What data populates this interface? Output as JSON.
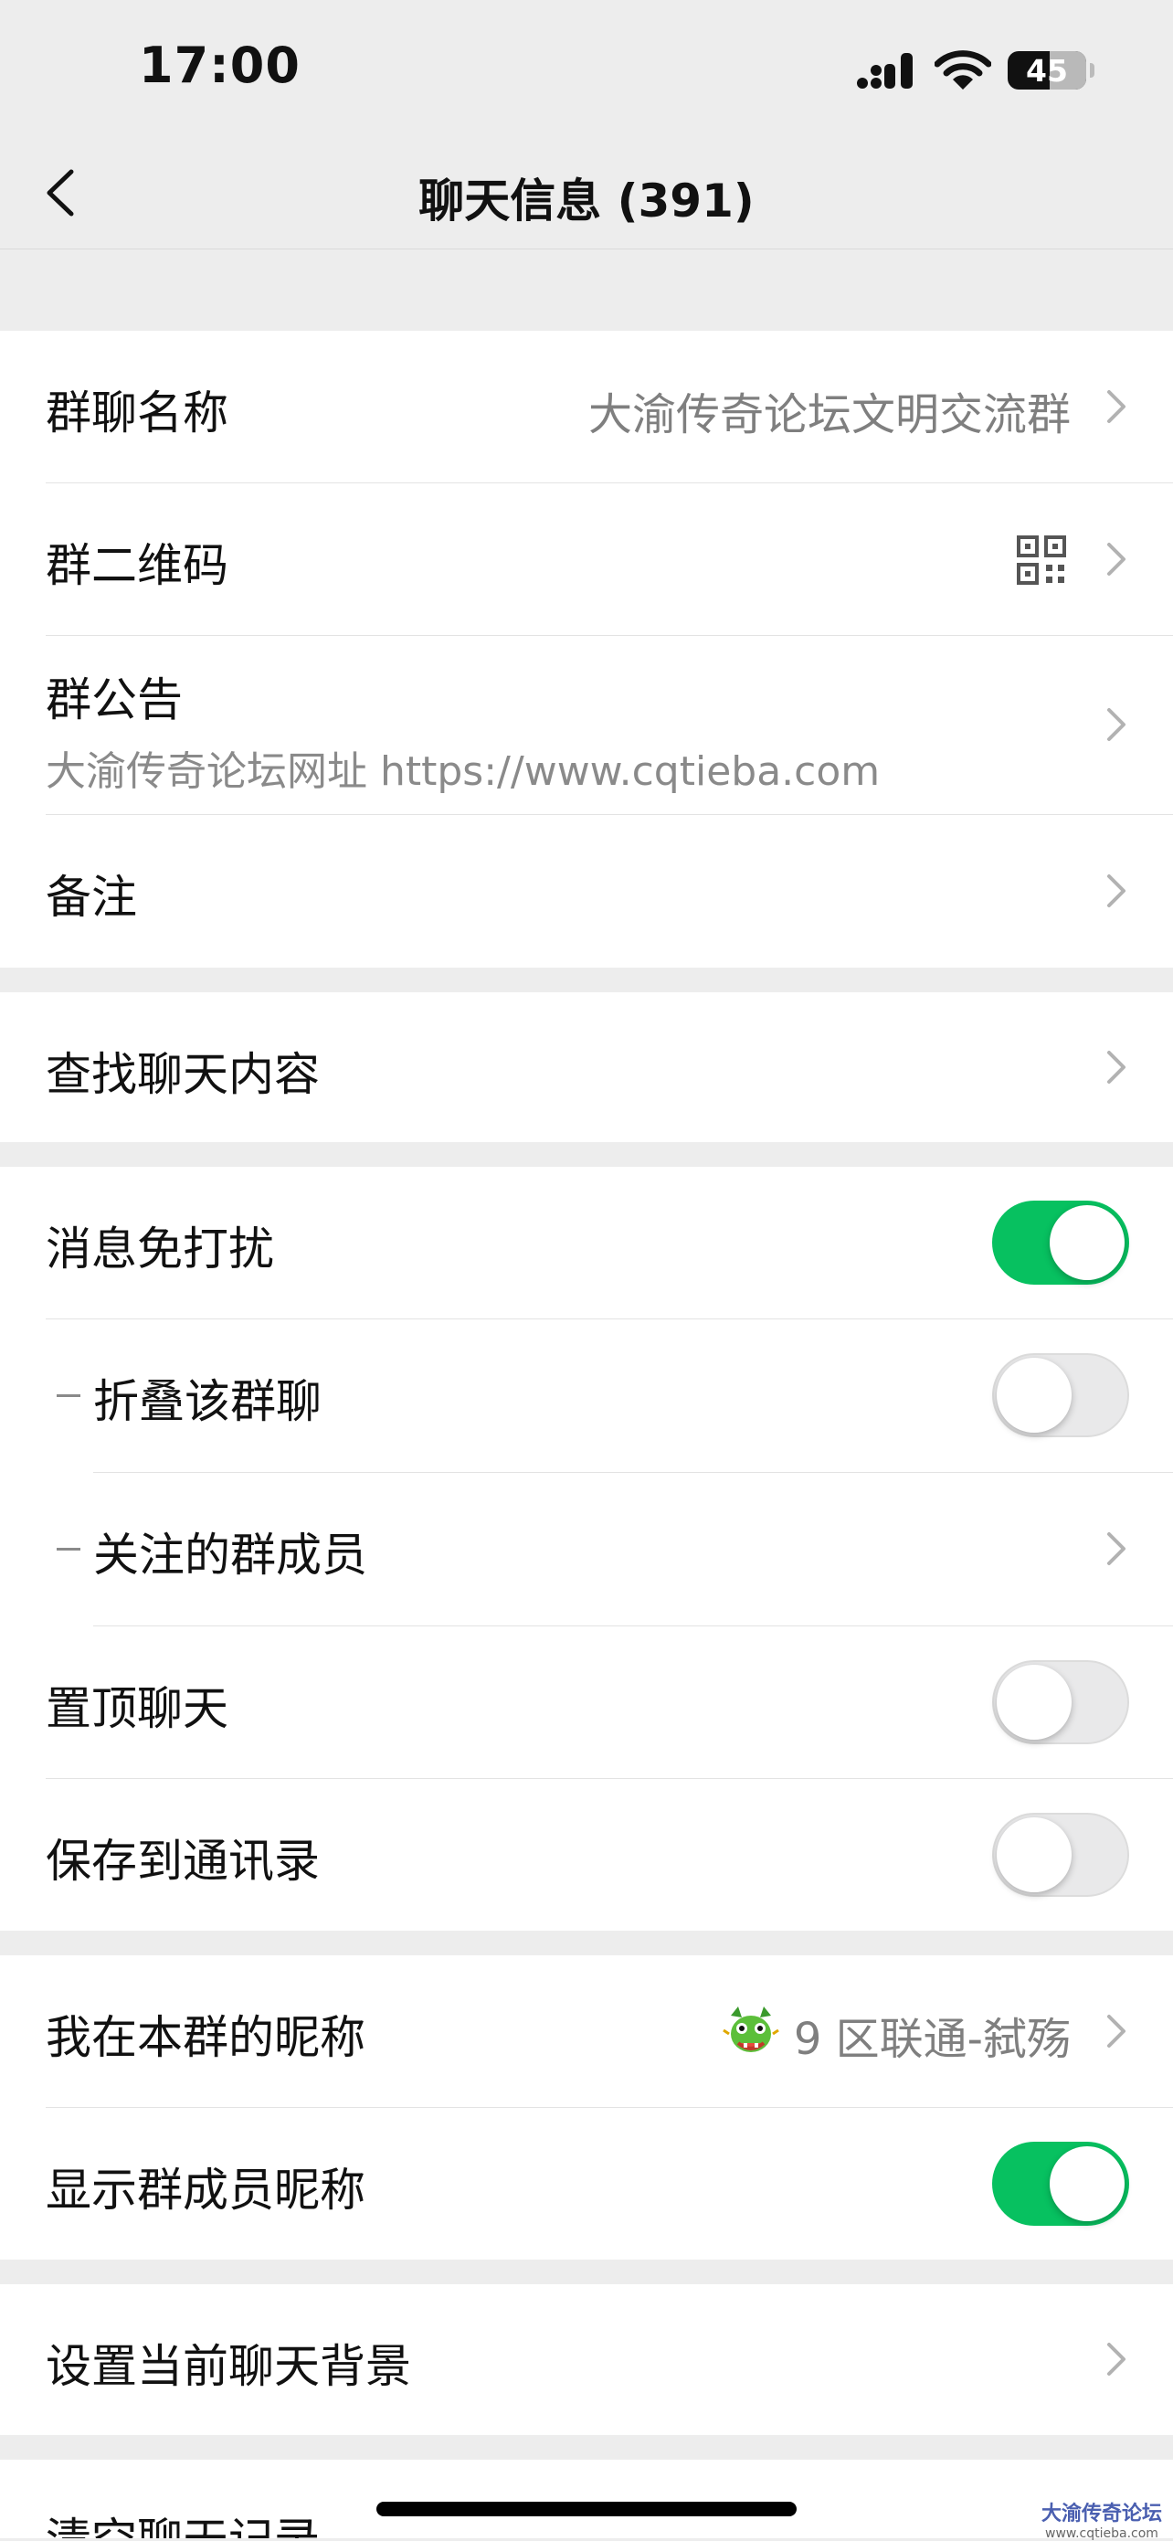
{
  "status": {
    "time": "17:00",
    "battery": "45"
  },
  "header": {
    "title": "聊天信息 (391)"
  },
  "group_name": {
    "label": "群聊名称",
    "value": "大渝传奇论坛文明交流群"
  },
  "qr_code": {
    "label": "群二维码"
  },
  "announcement": {
    "label": "群公告",
    "preview": "大渝传奇论坛网址 https://www.cqtieba.com"
  },
  "remark": {
    "label": "备注"
  },
  "search": {
    "label": "查找聊天内容"
  },
  "mute": {
    "label": "消息免打扰",
    "on": true
  },
  "fold": {
    "label": "折叠该群聊",
    "on": false
  },
  "followed_members": {
    "label": "关注的群成员"
  },
  "pin": {
    "label": "置顶聊天",
    "on": false
  },
  "save_contacts": {
    "label": "保存到通讯录",
    "on": false
  },
  "nickname": {
    "label": "我在本群的昵称",
    "value": "9 区联通-弑殇"
  },
  "show_nicknames": {
    "label": "显示群成员昵称",
    "on": true
  },
  "background": {
    "label": "设置当前聊天背景"
  },
  "clear_history": {
    "label": "清空聊天记录"
  },
  "watermark": {
    "title": "大渝传奇论坛",
    "url": "www.cqtieba.com"
  },
  "colors": {
    "accent": "#07c160",
    "background": "#ededed"
  }
}
